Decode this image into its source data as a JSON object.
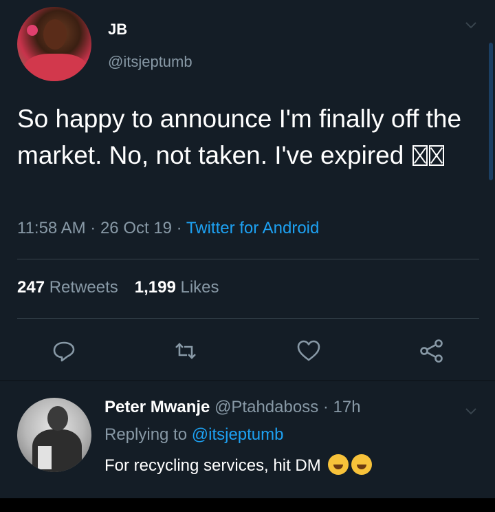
{
  "tweet": {
    "author_name": "JB",
    "author_handle": "@itsjeptumb",
    "text": "So happy to announce I'm finally off the market. No, not taken. I've expired",
    "time": "11:58 AM",
    "separator": " · ",
    "date": "26 Oct 19",
    "source": "Twitter for Android",
    "retweets_count": "247",
    "retweets_label": "Retweets",
    "likes_count": "1,199",
    "likes_label": "Likes"
  },
  "actions": [
    {
      "icon": "reply-icon"
    },
    {
      "icon": "retweet-icon"
    },
    {
      "icon": "like-heart-icon"
    },
    {
      "icon": "share-icon"
    }
  ],
  "reply": {
    "author_name": "Peter Mwanje",
    "author_handle": "@Ptahdaboss",
    "separator": " · ",
    "time": "17h",
    "replying_to_label": "Replying to",
    "replying_to_handle": "@itsjeptumb",
    "text": "For recycling services, hit DM"
  },
  "colors": {
    "background": "#141d26",
    "text": "#ffffff",
    "muted": "#8899a6",
    "link": "#1da1f2",
    "divider": "#38444d"
  }
}
